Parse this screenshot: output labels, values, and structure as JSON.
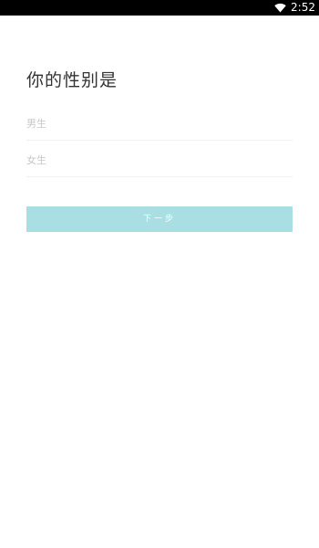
{
  "status_bar": {
    "wifi_icon": "wifi-icon",
    "time": "2:52"
  },
  "main": {
    "title": "你的性别是",
    "options": [
      {
        "label": "男生"
      },
      {
        "label": "女生"
      }
    ],
    "next_label": "下一步",
    "next_button_color": "#a9dfe3"
  }
}
